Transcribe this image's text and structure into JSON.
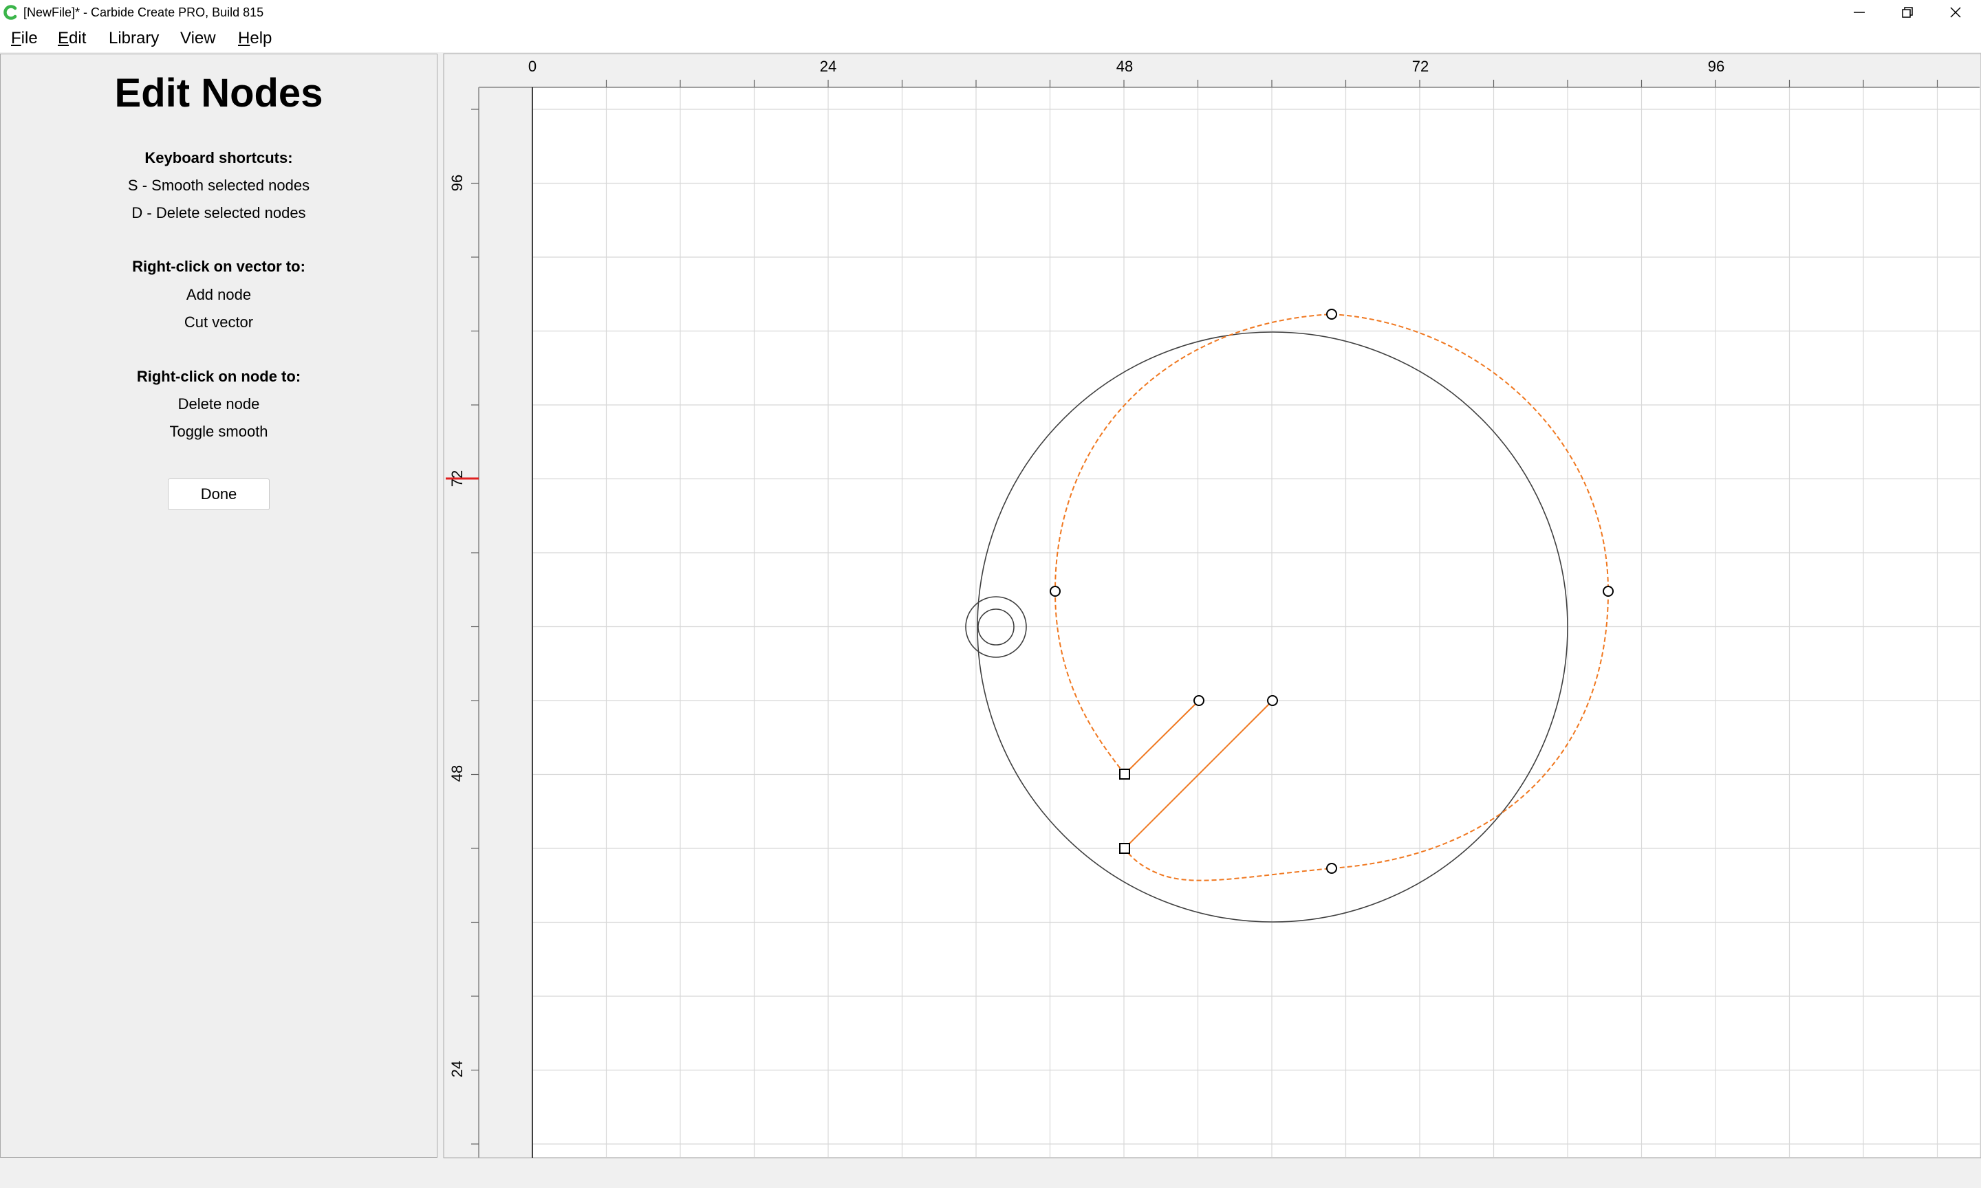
{
  "window": {
    "title": "[NewFile]* - Carbide Create PRO, Build 815",
    "app_icon": "carbide-c-icon",
    "controls": [
      "minimize-icon",
      "restore-icon",
      "close-icon"
    ]
  },
  "menu": [
    {
      "label": "File",
      "mnemonic": "F",
      "rest": "ile"
    },
    {
      "label": "Edit",
      "mnemonic": "E",
      "rest": "dit"
    },
    {
      "label": "Library",
      "mnemonic": "",
      "rest": "Library"
    },
    {
      "label": "View",
      "mnemonic": "",
      "rest": "View"
    },
    {
      "label": "Help",
      "mnemonic": "H",
      "rest": "elp"
    }
  ],
  "panel": {
    "title": "Edit Nodes",
    "shortcuts_heading": "Keyboard shortcuts:",
    "shortcuts": [
      "S - Smooth selected nodes",
      "D - Delete selected nodes"
    ],
    "vector_heading": "Right-click on vector to:",
    "vector_actions": [
      "Add node",
      "Cut vector"
    ],
    "node_heading": "Right-click on node to:",
    "node_actions": [
      "Delete node",
      "Toggle smooth"
    ],
    "done_label": "Done"
  },
  "canvas": {
    "ruler_top_labels": [
      "0",
      "24",
      "48",
      "72",
      "96"
    ],
    "ruler_left_labels": [
      "96",
      "72",
      "48",
      "24"
    ],
    "cursor_y_marker": 72,
    "colors": {
      "grid": "#d8d8d8",
      "path_selected": "#f07820",
      "shape": "#404040",
      "cursor_marker": "#e02020",
      "background": "#ffffff"
    }
  }
}
